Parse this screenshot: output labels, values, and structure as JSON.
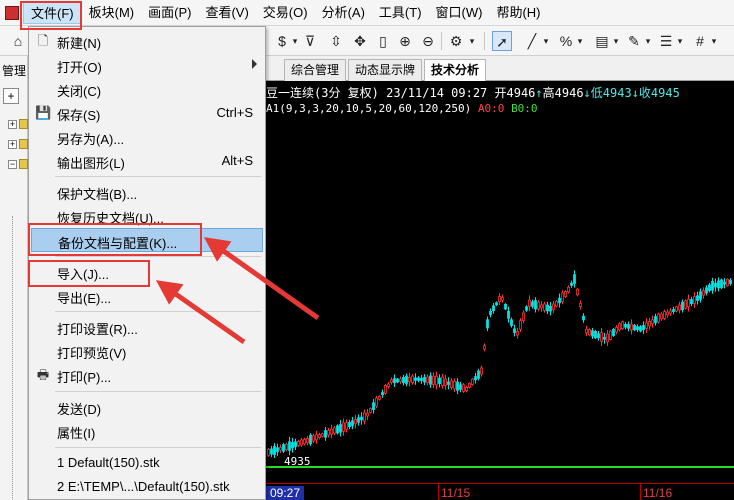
{
  "menubar": {
    "items": [
      "文件(F)",
      "板块(M)",
      "画面(P)",
      "查看(V)",
      "交易(O)",
      "分析(A)",
      "工具(T)",
      "窗口(W)",
      "帮助(H)"
    ]
  },
  "left_panel": {
    "title": "管理"
  },
  "tabs": [
    "综合管理",
    "动态显示牌",
    "技术分析"
  ],
  "chart": {
    "info_prefix": "豆一连续(3分 复权) 23/11/14 09:27 开4946",
    "info_high": "高4946",
    "info_low": "低4943",
    "info_close": "收4945",
    "indicator": "A1(9,3,3,20,10,5,20,60,120,250)",
    "a0": "A0:0",
    "b0": "B0:0",
    "low_mark": "4935",
    "time_labels": [
      "09:27",
      "11/15",
      "11/16"
    ]
  },
  "file_menu": {
    "items": [
      {
        "label": "新建(N)",
        "shortcut": "",
        "icon": "new-file-icon"
      },
      {
        "label": "打开(O)",
        "shortcut": "",
        "icon": ""
      },
      {
        "label": "关闭(C)",
        "shortcut": "",
        "icon": ""
      },
      {
        "label": "保存(S)",
        "shortcut": "Ctrl+S",
        "icon": "save-icon"
      },
      {
        "label": "另存为(A)...",
        "shortcut": "",
        "icon": ""
      },
      {
        "label": "输出图形(L)",
        "shortcut": "Alt+S",
        "icon": ""
      },
      {
        "label": "保护文档(B)...",
        "shortcut": "",
        "icon": ""
      },
      {
        "label": "恢复历史文档(U)...",
        "shortcut": "",
        "icon": ""
      },
      {
        "label": "备份文档与配置(K)...",
        "shortcut": "",
        "icon": ""
      },
      {
        "label": "导入(J)...",
        "shortcut": "",
        "icon": ""
      },
      {
        "label": "导出(E)...",
        "shortcut": "",
        "icon": ""
      },
      {
        "label": "打印设置(R)...",
        "shortcut": "",
        "icon": ""
      },
      {
        "label": "打印预览(V)",
        "shortcut": "",
        "icon": ""
      },
      {
        "label": "打印(P)...",
        "shortcut": "",
        "icon": "printer-icon"
      },
      {
        "label": "发送(D)",
        "shortcut": "",
        "icon": ""
      },
      {
        "label": "属性(I)",
        "shortcut": "",
        "icon": ""
      },
      {
        "label": "1 Default(150).stk",
        "shortcut": "",
        "icon": ""
      },
      {
        "label": "2 E:\\TEMP\\...\\Default(150).stk",
        "shortcut": "",
        "icon": ""
      }
    ]
  },
  "colors": {
    "highlight": "#a9cef0",
    "annotation": "#e53935",
    "candle_up": "#ff3030",
    "candle_down": "#00e5e5",
    "chart_bg": "#000000"
  }
}
